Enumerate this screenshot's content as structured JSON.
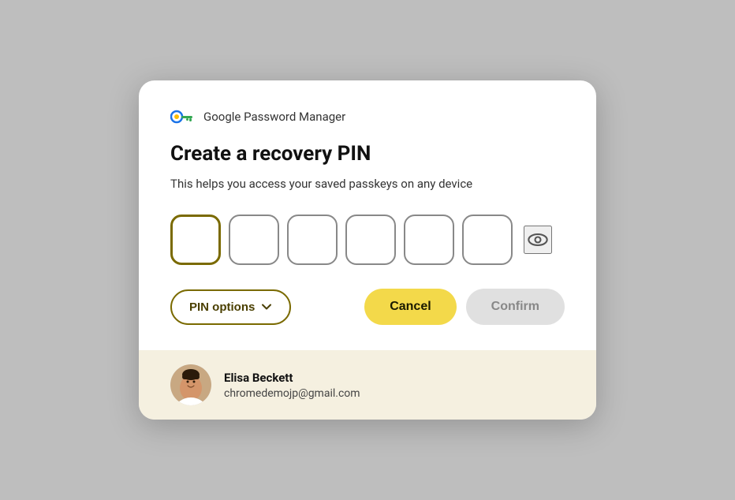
{
  "dialog": {
    "header": {
      "app_name": "Google Password Manager",
      "icon_label": "google-password-manager-icon"
    },
    "heading": "Create a recovery PIN",
    "subtext": "This helps you access your saved passkeys on any device",
    "pin_fields": {
      "count": 6,
      "placeholder": "",
      "eye_icon_label": "toggle-pin-visibility"
    },
    "pin_options_label": "PIN options",
    "cancel_label": "Cancel",
    "confirm_label": "Confirm"
  },
  "account": {
    "name": "Elisa Beckett",
    "email": "chromedemojp@gmail.com"
  },
  "colors": {
    "pin_options_border": "#7a6a00",
    "cancel_bg": "#f3d94a",
    "confirm_bg": "#e0e0e0",
    "account_bar_bg": "#f5f0e0"
  }
}
